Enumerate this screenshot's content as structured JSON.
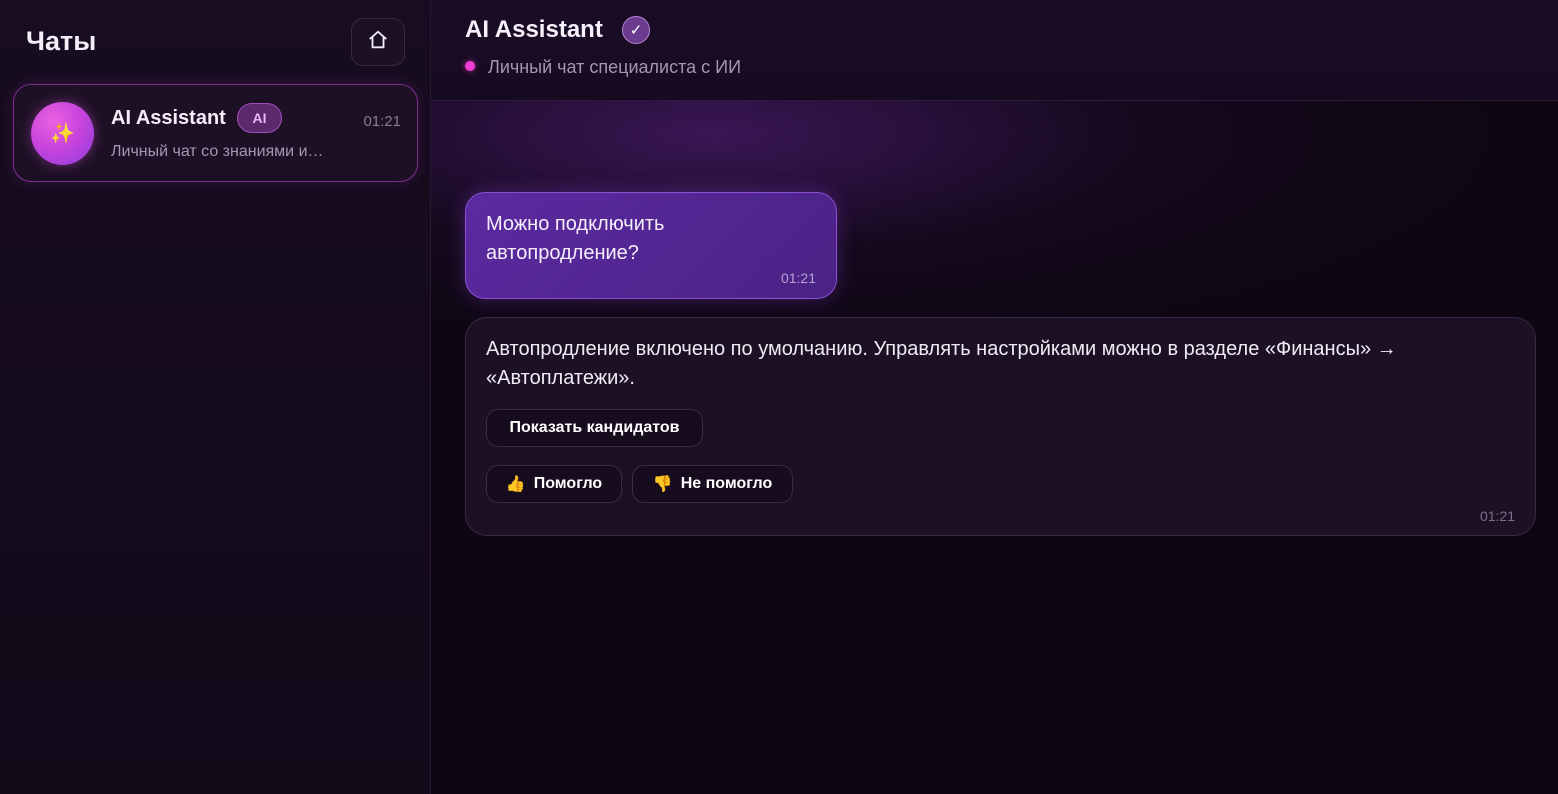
{
  "sidebar": {
    "title": "Чаты",
    "home_icon": "home-icon",
    "chats": [
      {
        "name": "AI Assistant",
        "badge": "AI",
        "time": "01:21",
        "preview": "Личный чат со знаниями и…",
        "avatar_icon": "sparkles-icon",
        "avatar_glyph": "✨"
      }
    ]
  },
  "header": {
    "title": "AI Assistant",
    "verified_glyph": "✓",
    "status_text": "Личный чат специалиста с ИИ"
  },
  "messages": [
    {
      "role": "user",
      "text": "Можно подключить автопродление?",
      "time": "01:21"
    },
    {
      "role": "assistant",
      "text": "Автопродление включено по умолчанию. Управлять настройками можно в разделе «Финансы» → «Автоплатежи».",
      "time": "01:21",
      "show_candidates_label": "Показать кандидатов",
      "helped_label": "Помогло",
      "helped_glyph": "👍",
      "not_helped_label": "Не помогло",
      "not_helped_glyph": "👎"
    }
  ],
  "colors": {
    "accent": "#ef3fd6",
    "user_bubble": "#5b2aa0",
    "badge": "#5a2a6d"
  }
}
